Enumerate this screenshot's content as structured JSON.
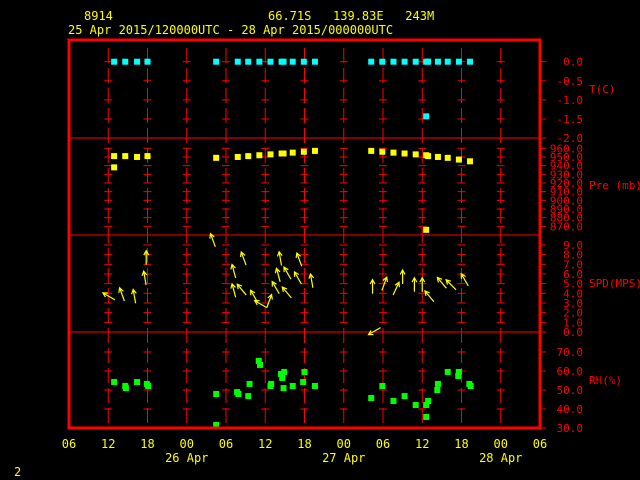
{
  "header": {
    "station_id": "8914",
    "location": "66.71S   139.83E   243M",
    "period": "25 Apr 2015/120000UTC - 28 Apr 2015/000000UTC",
    "page_number": "2"
  },
  "colors": {
    "frame": "#ff0000",
    "text": "#ffff00",
    "temperature": "#00ffff",
    "pressure": "#ffff00",
    "wind": "#ffff00",
    "rh": "#00ff00",
    "background": "#000000"
  },
  "chart_data": {
    "type": "scatter",
    "time_axis": {
      "unit": "hours since 25 Apr 2015 00UTC",
      "range": [
        6,
        78
      ],
      "tick_hours": [
        6,
        12,
        18,
        24,
        30,
        36,
        42,
        48,
        54,
        60,
        66,
        72,
        78
      ],
      "tick_labels": [
        "06",
        "12",
        "18",
        "00",
        "06",
        "12",
        "18",
        "00",
        "06",
        "12",
        "18",
        "00",
        "06"
      ],
      "day_labels": [
        {
          "hour": 24,
          "label": "26 Apr"
        },
        {
          "hour": 48,
          "label": "27 Apr"
        },
        {
          "hour": 72,
          "label": "28 Apr"
        }
      ]
    },
    "panels": [
      {
        "id": "temperature",
        "label": "T(C)",
        "range": [
          -2.0,
          0.0
        ],
        "ticks": [
          "0.0",
          "-0.5",
          "-1.0",
          "-1.5",
          "-2.0"
        ],
        "tick_values": [
          0,
          -0.5,
          -1,
          -1.5,
          -2
        ],
        "points": [
          [
            12.9,
            0
          ],
          [
            14.6,
            0
          ],
          [
            16.4,
            0
          ],
          [
            18.0,
            0
          ],
          [
            28.5,
            0
          ],
          [
            31.8,
            0
          ],
          [
            33.4,
            0
          ],
          [
            35.1,
            0
          ],
          [
            36.8,
            0
          ],
          [
            38.5,
            0
          ],
          [
            38.8,
            0
          ],
          [
            40.2,
            0
          ],
          [
            41.9,
            0
          ],
          [
            43.6,
            0
          ],
          [
            52.2,
            0
          ],
          [
            53.9,
            0
          ],
          [
            55.6,
            0
          ],
          [
            57.3,
            0
          ],
          [
            59.0,
            0
          ],
          [
            60.6,
            0
          ],
          [
            60.9,
            0
          ],
          [
            62.4,
            0
          ],
          [
            63.9,
            0
          ],
          [
            65.6,
            0
          ],
          [
            67.3,
            0
          ],
          [
            60.6,
            -1.43
          ]
        ]
      },
      {
        "id": "pressure",
        "label": "Pre (mb)",
        "range": [
          870,
          960
        ],
        "ticks": [
          "960.0",
          "950.0",
          "940.0",
          "930.0",
          "920.0",
          "910.0",
          "900.0",
          "890.0",
          "880.0",
          "870.0"
        ],
        "tick_values": [
          960,
          950,
          940,
          930,
          920,
          910,
          900,
          890,
          880,
          870
        ],
        "points": [
          [
            12.9,
            951
          ],
          [
            12.9,
            938
          ],
          [
            14.6,
            951
          ],
          [
            16.4,
            950
          ],
          [
            18.0,
            951
          ],
          [
            28.5,
            949
          ],
          [
            31.8,
            950
          ],
          [
            33.4,
            951
          ],
          [
            35.1,
            952
          ],
          [
            36.8,
            953
          ],
          [
            38.5,
            954
          ],
          [
            38.8,
            954
          ],
          [
            40.2,
            955
          ],
          [
            41.9,
            956
          ],
          [
            43.6,
            957
          ],
          [
            52.2,
            957
          ],
          [
            53.9,
            956
          ],
          [
            55.6,
            955
          ],
          [
            57.3,
            954
          ],
          [
            59.0,
            953
          ],
          [
            60.6,
            952
          ],
          [
            60.9,
            951
          ],
          [
            62.4,
            950
          ],
          [
            63.9,
            949
          ],
          [
            65.6,
            947
          ],
          [
            67.3,
            945
          ],
          [
            60.6,
            866
          ]
        ]
      },
      {
        "id": "wind_speed",
        "label": "SPD(MPS)",
        "range": [
          0,
          10
        ],
        "ticks": [
          "9.0",
          "8.0",
          "7.0",
          "6.0",
          "5.0",
          "4.0",
          "3.0",
          "2.0",
          "1.0",
          "0.0"
        ],
        "tick_values": [
          9,
          8,
          7,
          6,
          5,
          4,
          3,
          2,
          1,
          0
        ],
        "arrows_note": "each point: [hour, speed m/s, arrow pointing direction deg]",
        "points": [
          [
            12.1,
            4.1,
            300
          ],
          [
            14.1,
            4.3,
            340
          ],
          [
            16.0,
            4.1,
            350
          ],
          [
            17.6,
            6.0,
            350
          ],
          [
            17.8,
            8.1,
            0
          ],
          [
            28.0,
            9.9,
            340
          ],
          [
            31.2,
            4.7,
            345
          ],
          [
            32.4,
            4.8,
            320
          ],
          [
            31.2,
            6.7,
            345
          ],
          [
            32.7,
            8.0,
            340
          ],
          [
            34.3,
            4.1,
            330
          ],
          [
            35.3,
            3.3,
            300
          ],
          [
            36.6,
            3.6,
            20
          ],
          [
            37.6,
            5.0,
            330
          ],
          [
            38.0,
            6.3,
            345
          ],
          [
            38.3,
            8.0,
            350
          ],
          [
            39.3,
            4.5,
            320
          ],
          [
            39.4,
            6.5,
            330
          ],
          [
            41.0,
            6.0,
            330
          ],
          [
            41.2,
            7.9,
            340
          ],
          [
            43.1,
            5.7,
            350
          ],
          [
            52.4,
            5.1,
            0
          ],
          [
            54.2,
            5.4,
            20
          ],
          [
            56.0,
            4.9,
            25
          ],
          [
            57.0,
            6.1,
            0
          ],
          [
            58.8,
            5.3,
            0
          ],
          [
            60.0,
            5.3,
            0
          ],
          [
            61.1,
            4.1,
            320
          ],
          [
            63.0,
            5.5,
            320
          ],
          [
            64.4,
            5.3,
            315
          ],
          [
            66.5,
            5.8,
            330
          ],
          [
            52.7,
            0.5,
            240
          ]
        ]
      },
      {
        "id": "rh",
        "label": "RH(%)",
        "range": [
          30,
          70
        ],
        "ticks": [
          "70.0",
          "60.0",
          "50.0",
          "40.0",
          "30.0"
        ],
        "tick_values": [
          70,
          60,
          50,
          40,
          30
        ],
        "points": [
          [
            12.9,
            54.2
          ],
          [
            14.6,
            52.1
          ],
          [
            14.7,
            51
          ],
          [
            16.4,
            54.2
          ],
          [
            17.9,
            53.2
          ],
          [
            18.1,
            52.1
          ],
          [
            28.5,
            47.9
          ],
          [
            28.5,
            31.6
          ],
          [
            31.7,
            48.9
          ],
          [
            31.9,
            47.9
          ],
          [
            33.4,
            46.8
          ],
          [
            33.6,
            53.2
          ],
          [
            35.0,
            65.3
          ],
          [
            35.2,
            63.2
          ],
          [
            36.8,
            52.1
          ],
          [
            36.9,
            53.2
          ],
          [
            38.4,
            58.4
          ],
          [
            38.6,
            56.3
          ],
          [
            38.9,
            59.5
          ],
          [
            38.8,
            51
          ],
          [
            40.2,
            52.1
          ],
          [
            41.8,
            54.2
          ],
          [
            42.0,
            59.5
          ],
          [
            43.6,
            52.1
          ],
          [
            52.2,
            45.8
          ],
          [
            53.9,
            52.1
          ],
          [
            55.6,
            44.2
          ],
          [
            57.3,
            46.8
          ],
          [
            59.0,
            42.1
          ],
          [
            60.6,
            42.1
          ],
          [
            60.9,
            44.2
          ],
          [
            60.6,
            35.8
          ],
          [
            62.3,
            50
          ],
          [
            62.4,
            53.2
          ],
          [
            63.9,
            59.5
          ],
          [
            65.5,
            57.4
          ],
          [
            65.6,
            59.5
          ],
          [
            67.2,
            53.2
          ],
          [
            67.4,
            52.1
          ]
        ]
      }
    ]
  }
}
